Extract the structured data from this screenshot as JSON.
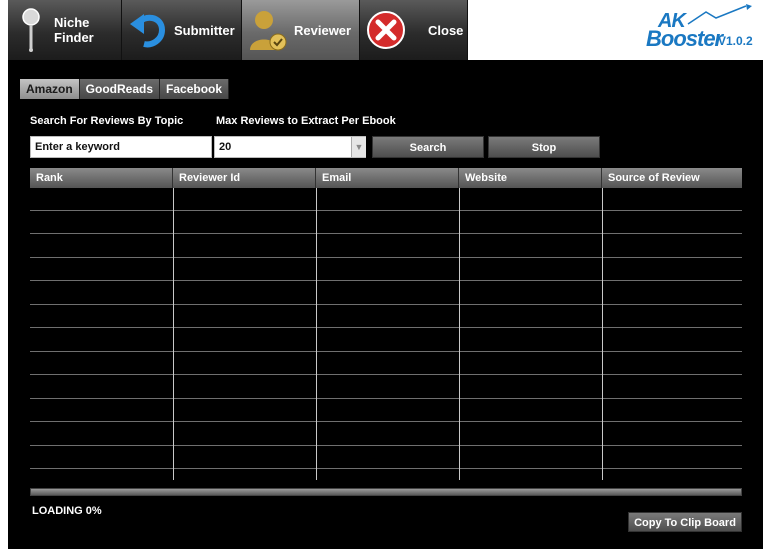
{
  "toolbar": {
    "niche_finder": "Niche Finder",
    "submitter": "Submitter",
    "reviewer": "Reviewer",
    "close": "Close"
  },
  "logo": {
    "line1": "AK",
    "line2": "Booster",
    "version": "V1.0.2"
  },
  "tabs": [
    {
      "label": "Amazon",
      "active": true
    },
    {
      "label": "GoodReads",
      "active": false
    },
    {
      "label": "Facebook",
      "active": false
    }
  ],
  "search": {
    "topic_label": "Search For Reviews By Topic",
    "max_label": "Max Reviews to Extract Per Ebook",
    "keyword_value": "Enter a keyword",
    "max_value": "20",
    "search_button": "Search",
    "stop_button": "Stop"
  },
  "grid": {
    "columns": [
      "Rank",
      "Reviewer Id",
      "Email",
      "Website",
      "Source of Review"
    ]
  },
  "status": {
    "loading": "LOADING 0%"
  },
  "copy_button": "Copy To Clip Board",
  "colors": {
    "panel": "#000000",
    "logo": "#1a78c2",
    "close_icon": "#d42b2b",
    "reviewer_icon": "#c9a13a"
  }
}
